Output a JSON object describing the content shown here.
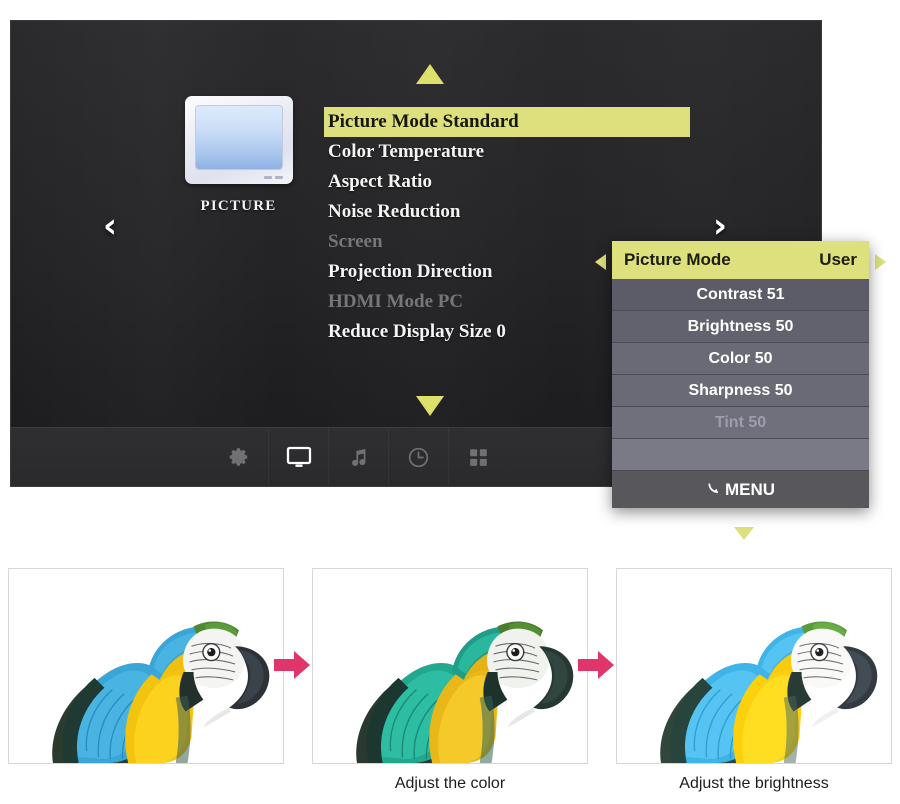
{
  "osd": {
    "category": {
      "label": "PICTURE",
      "icon": "tv-monitor-icon"
    },
    "nav": {
      "left_chevron": "‹",
      "right_chevron": "›",
      "scroll_up_icon": "triangle-up-icon",
      "scroll_down_icon": "triangle-down-icon"
    },
    "menu_items": [
      {
        "label": "Picture Mode Standard",
        "state": "selected"
      },
      {
        "label": "Color Temperature",
        "state": "normal"
      },
      {
        "label": "Aspect Ratio",
        "state": "normal"
      },
      {
        "label": "Noise Reduction",
        "state": "normal"
      },
      {
        "label": "Screen",
        "state": "disabled"
      },
      {
        "label": "Projection Direction",
        "state": "normal"
      },
      {
        "label": "HDMI Mode PC",
        "state": "disabled"
      },
      {
        "label": "Reduce Display Size 0",
        "state": "normal"
      }
    ],
    "taskbar": [
      {
        "icon": "gear-icon",
        "active": false
      },
      {
        "icon": "display-monitor-icon",
        "active": true
      },
      {
        "icon": "music-note-icon",
        "active": false
      },
      {
        "icon": "clock-icon",
        "active": false
      },
      {
        "icon": "apps-grid-icon",
        "active": false
      }
    ]
  },
  "submenu": {
    "header": {
      "title": "Picture Mode",
      "value": "User"
    },
    "rows": [
      {
        "label": "Contrast 51",
        "state": "normal"
      },
      {
        "label": "Brightness 50",
        "state": "normal"
      },
      {
        "label": "Color 50",
        "state": "normal"
      },
      {
        "label": "Sharpness 50",
        "state": "normal"
      },
      {
        "label": "Tint 50",
        "state": "disabled"
      },
      {
        "label": "",
        "state": "blank"
      }
    ],
    "footer": {
      "label": "MENU",
      "icon": "back-arrow-icon"
    },
    "triangles": {
      "left": "triangle-left-icon",
      "right": "triangle-right-icon",
      "down": "triangle-down-icon"
    }
  },
  "photos": [
    {
      "alt": "blue-and-gold-macaw-original",
      "caption": ""
    },
    {
      "alt": "blue-and-gold-macaw-color-adjusted",
      "caption": "Adjust the color"
    },
    {
      "alt": "blue-and-gold-macaw-brightness-adjusted",
      "caption": "Adjust the brightness"
    }
  ],
  "flow_arrows": [
    {
      "icon": "arrow-right-icon"
    },
    {
      "icon": "arrow-right-icon"
    }
  ],
  "colors": {
    "highlight": "#dde07c",
    "panel_bg": "#242426",
    "submenu_bg": "#5a5a66",
    "arrow_pink": "#e0356b"
  }
}
